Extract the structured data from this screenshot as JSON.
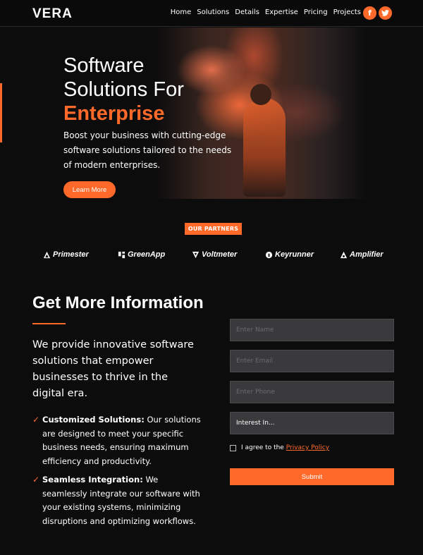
{
  "nav": {
    "logo": "VERA",
    "items": [
      "Home",
      "Solutions",
      "Details",
      "Expertise",
      "Pricing",
      "Projects"
    ],
    "social": [
      {
        "icon": "facebook-icon",
        "glyph": "f"
      },
      {
        "icon": "twitter-icon",
        "glyph": "t"
      }
    ]
  },
  "hero": {
    "title_line1": "Software",
    "title_line2": "Solutions For",
    "title_accent": "Enterprise",
    "description": "Boost your business with cutting-edge software solutions tailored to the needs of modern enterprises.",
    "cta_label": "Learn More"
  },
  "partners": {
    "label": "OUR PARTNERS",
    "items": [
      "Primester",
      "GreenApp",
      "Voltmeter",
      "Keyrunner",
      "Amplifier"
    ]
  },
  "info": {
    "title": "Get More Information",
    "lead": "We provide innovative software solutions that empower businesses to thrive in the digital era.",
    "bullets": [
      {
        "strong": "Customized Solutions:",
        "text": " Our solutions are designed to meet your specific business needs, ensuring maximum efficiency and productivity."
      },
      {
        "strong": "Seamless Integration:",
        "text": " We seamlessly integrate our software with your existing systems, minimizing disruptions and optimizing workflows."
      }
    ]
  },
  "form": {
    "name_placeholder": "Enter Name",
    "email_placeholder": "Enter Email",
    "phone_placeholder": "Enter Phone",
    "interest_value": "Interest In...",
    "agree_text": "I agree to the ",
    "privacy_link": "Privacy Policy",
    "submit_label": "Submit"
  },
  "colors": {
    "accent": "#ff6a2b",
    "background": "#0c0c0d"
  }
}
